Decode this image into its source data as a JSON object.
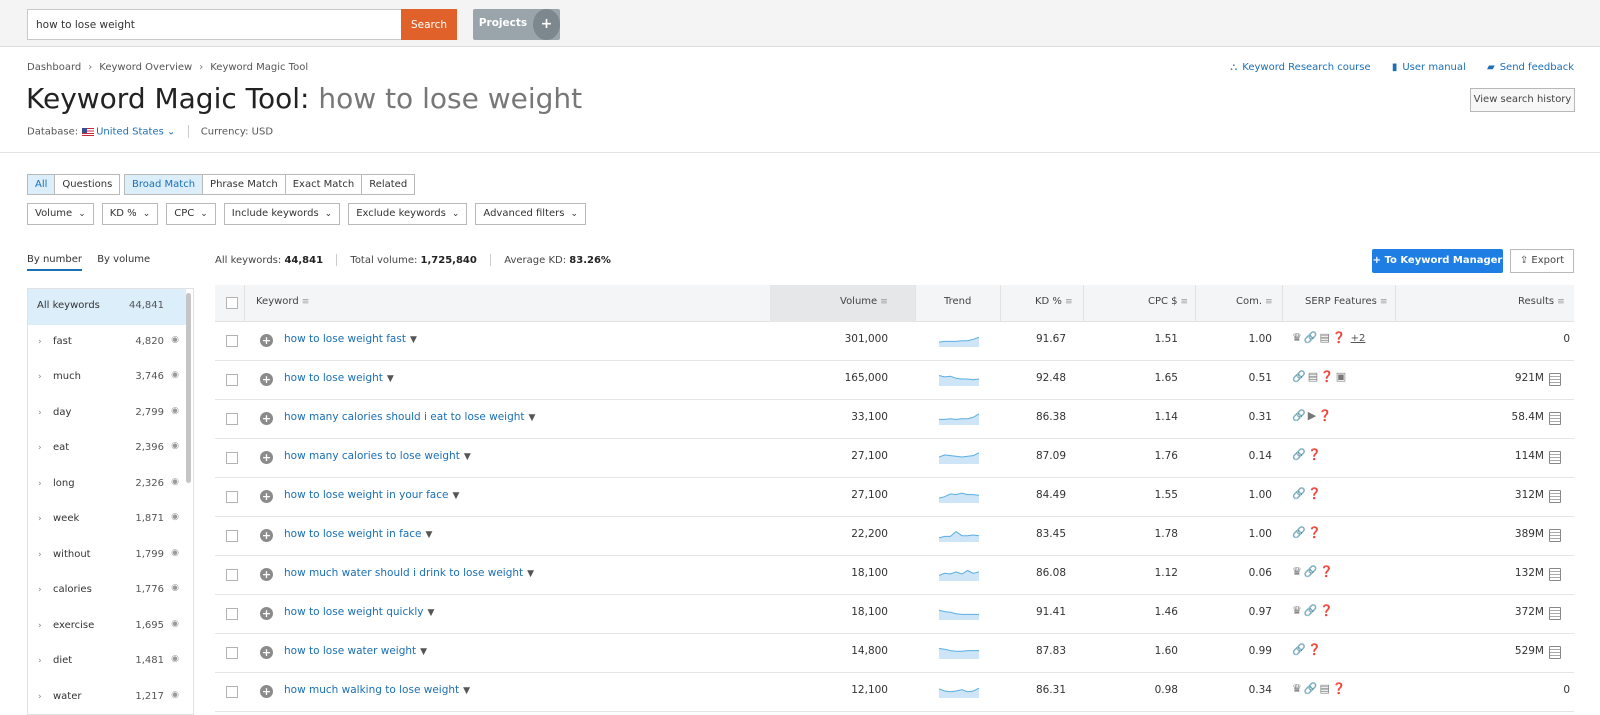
{
  "search": {
    "value": "how to lose weight",
    "clear_icon": "×",
    "button_label": "Search"
  },
  "projects": {
    "label": "Projects",
    "add_label": "+"
  },
  "breadcrumb": [
    "Dashboard",
    "Keyword Overview",
    "Keyword Magic Tool"
  ],
  "breadcrumb_sep": "›",
  "help_links": {
    "course": "Keyword Research course",
    "manual": "User manual",
    "feedback": "Send feedback"
  },
  "page_title": {
    "tool": "Keyword Magic Tool:",
    "query": "how to lose weight"
  },
  "history_button": "View search history",
  "database": {
    "label": "Database:",
    "country": "United States",
    "currency_label": "Currency:",
    "currency": "USD"
  },
  "type_tabs": [
    {
      "label": "All",
      "active": true
    },
    {
      "label": "Questions",
      "active": false
    }
  ],
  "match_tabs": [
    {
      "label": "Broad Match",
      "active": true
    },
    {
      "label": "Phrase Match",
      "active": false
    },
    {
      "label": "Exact Match",
      "active": false
    },
    {
      "label": "Related",
      "active": false
    }
  ],
  "filters": [
    "Volume",
    "KD %",
    "CPC",
    "Include keywords",
    "Exclude keywords",
    "Advanced filters"
  ],
  "sidebar": {
    "tab_number": "By number",
    "tab_volume": "By volume",
    "items": [
      {
        "name": "All keywords",
        "count": "44,841"
      },
      {
        "name": "fast",
        "count": "4,820"
      },
      {
        "name": "much",
        "count": "3,746"
      },
      {
        "name": "day",
        "count": "2,799"
      },
      {
        "name": "eat",
        "count": "2,396"
      },
      {
        "name": "long",
        "count": "2,326"
      },
      {
        "name": "week",
        "count": "1,871"
      },
      {
        "name": "without",
        "count": "1,799"
      },
      {
        "name": "calories",
        "count": "1,776"
      },
      {
        "name": "exercise",
        "count": "1,695"
      },
      {
        "name": "diet",
        "count": "1,481"
      },
      {
        "name": "water",
        "count": "1,217"
      }
    ]
  },
  "stats": {
    "all_label": "All keywords:",
    "all_value": "44,841",
    "volume_label": "Total volume:",
    "volume_value": "1,725,840",
    "kd_label": "Average KD:",
    "kd_value": "83.26%"
  },
  "keyword_manager_button": "To Keyword Manager",
  "export_button": "Export",
  "columns": {
    "keyword": "Keyword",
    "volume": "Volume",
    "trend": "Trend",
    "kd": "KD %",
    "cpc": "CPC $",
    "com": "Com.",
    "serp": "SERP Features",
    "results": "Results"
  },
  "rows": [
    {
      "keyword": "how to lose weight fast",
      "volume": "301,000",
      "kd": "91.67",
      "cpc": "1.51",
      "com": "1.00",
      "serp": "♛🔗▤❓",
      "serp_more": "+2",
      "results": "0",
      "trend": [
        0.65,
        0.6,
        0.6,
        0.6,
        0.55,
        0.55,
        0.45,
        0.3
      ]
    },
    {
      "keyword": "how to lose weight",
      "volume": "165,000",
      "kd": "92.48",
      "cpc": "1.65",
      "com": "0.51",
      "serp": "🔗▤❓▣",
      "serp_more": "",
      "results": "921M",
      "trend": [
        0.25,
        0.35,
        0.3,
        0.45,
        0.5,
        0.5,
        0.55,
        0.5
      ]
    },
    {
      "keyword": "how many calories should i eat to lose weight",
      "volume": "33,100",
      "kd": "86.38",
      "cpc": "1.14",
      "com": "0.31",
      "serp": "🔗▶❓",
      "serp_more": "",
      "results": "58.4M",
      "trend": [
        0.6,
        0.6,
        0.55,
        0.6,
        0.55,
        0.55,
        0.45,
        0.2
      ]
    },
    {
      "keyword": "how many calories to lose weight",
      "volume": "27,100",
      "kd": "87.09",
      "cpc": "1.76",
      "com": "0.14",
      "serp": "🔗❓",
      "serp_more": "",
      "results": "114M",
      "trend": [
        0.5,
        0.35,
        0.4,
        0.45,
        0.5,
        0.45,
        0.4,
        0.2
      ]
    },
    {
      "keyword": "how to lose weight in your face",
      "volume": "27,100",
      "kd": "84.49",
      "cpc": "1.55",
      "com": "1.00",
      "serp": "🔗❓",
      "serp_more": "",
      "results": "312M",
      "trend": [
        0.65,
        0.55,
        0.35,
        0.4,
        0.3,
        0.4,
        0.4,
        0.45
      ]
    },
    {
      "keyword": "how to lose weight in face",
      "volume": "22,200",
      "kd": "83.45",
      "cpc": "1.78",
      "com": "1.00",
      "serp": "🔗❓",
      "serp_more": "",
      "results": "389M",
      "trend": [
        0.7,
        0.6,
        0.6,
        0.25,
        0.55,
        0.55,
        0.5,
        0.55
      ]
    },
    {
      "keyword": "how much water should i drink to lose weight",
      "volume": "18,100",
      "kd": "86.08",
      "cpc": "1.12",
      "com": "0.06",
      "serp": "♛🔗❓",
      "serp_more": "",
      "results": "132M",
      "trend": [
        0.6,
        0.45,
        0.5,
        0.35,
        0.5,
        0.25,
        0.45,
        0.35
      ]
    },
    {
      "keyword": "how to lose weight quickly",
      "volume": "18,100",
      "kd": "91.41",
      "cpc": "1.46",
      "com": "0.97",
      "serp": "♛🔗❓",
      "serp_more": "",
      "results": "372M",
      "trend": [
        0.3,
        0.4,
        0.45,
        0.55,
        0.6,
        0.6,
        0.6,
        0.6
      ]
    },
    {
      "keyword": "how to lose water weight",
      "volume": "14,800",
      "kd": "87.83",
      "cpc": "1.60",
      "com": "0.99",
      "serp": "🔗❓",
      "serp_more": "",
      "results": "529M",
      "trend": [
        0.25,
        0.3,
        0.4,
        0.45,
        0.45,
        0.4,
        0.4,
        0.4
      ]
    },
    {
      "keyword": "how much walking to lose weight",
      "volume": "12,100",
      "kd": "86.31",
      "cpc": "0.98",
      "com": "0.34",
      "serp": "♛🔗▤❓",
      "serp_more": "",
      "results": "0",
      "trend": [
        0.35,
        0.5,
        0.55,
        0.5,
        0.4,
        0.55,
        0.5,
        0.3
      ]
    }
  ],
  "colors": {
    "accent": "#1b6fb5",
    "search_button": "#e0622a",
    "primary_button": "#1e7ee4",
    "active_tab_bg": "#dbeefa"
  }
}
